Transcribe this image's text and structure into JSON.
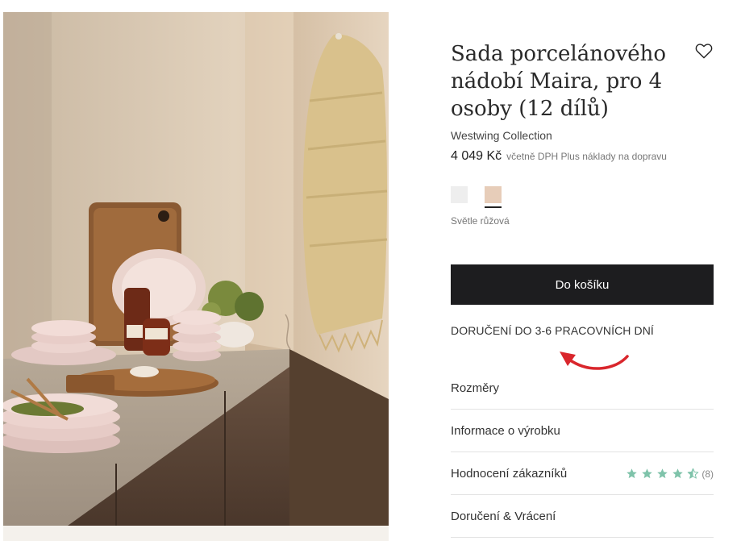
{
  "product": {
    "title": "Sada porcelánového nádobí Maira, pro 4 osoby (12 dílů)",
    "brand": "Westwing Collection",
    "price": "4 049 Kč",
    "price_note": "včetně DPH Plus náklady na dopravu",
    "image_alt": "Sada porcelánového nádobí Maira na kuchyňské lince",
    "wishlist_icon": "heart-outline-icon"
  },
  "colors": {
    "selected_name": "Světle růžová",
    "swatches": [
      "#eeeeee",
      "#e7cdb9"
    ],
    "selected_index": 1
  },
  "actions": {
    "add_to_cart": "Do košíku",
    "delivery": "DORUČENÍ DO 3-6 PRACOVNÍCH DNÍ"
  },
  "accordion": [
    {
      "label": "Rozměry"
    },
    {
      "label": "Informace o výrobku"
    },
    {
      "label": "Hodnocení zákazníků",
      "rating": 4.5,
      "rating_count": "(8)"
    },
    {
      "label": "Doručení & Vrácení"
    }
  ],
  "theme": {
    "star_color": "#7fc3aa",
    "arrow_color": "#d9262c",
    "button_color": "#1d1d1f"
  }
}
